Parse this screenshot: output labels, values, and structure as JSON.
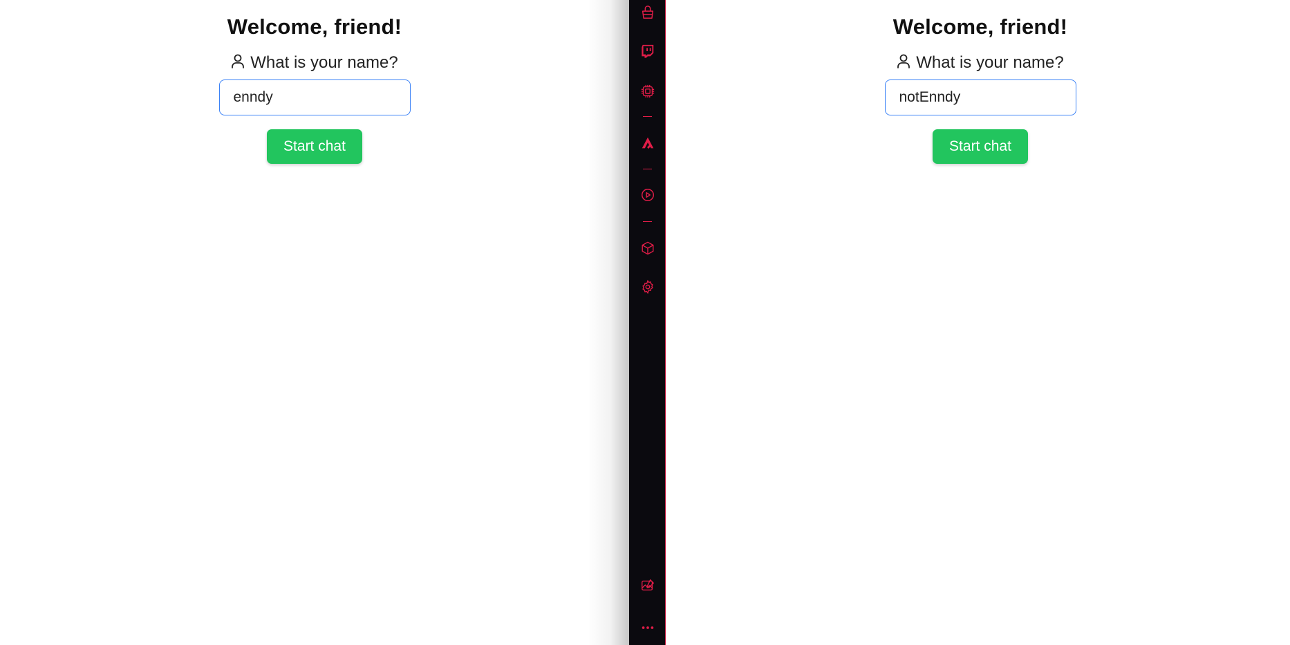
{
  "left_pane": {
    "welcome": "Welcome, friend!",
    "name_prompt": "What is your name?",
    "name_value": "enndy",
    "start_button": "Start chat"
  },
  "right_pane": {
    "welcome": "Welcome, friend!",
    "name_prompt": "What is your name?",
    "name_value": "notEnndy",
    "start_button": "Start chat"
  },
  "sidebar": {
    "accent_color": "#e11d48",
    "background_color": "#0b0a0f",
    "icons": [
      "shopping-bag-icon",
      "twitch-icon",
      "chip-icon",
      "arc-icon",
      "play-circle-icon",
      "cube-icon",
      "gear-icon",
      "photo-edit-icon",
      "more-icon"
    ]
  },
  "colors": {
    "input_border": "#3b82f6",
    "button_bg": "#22c55e"
  }
}
